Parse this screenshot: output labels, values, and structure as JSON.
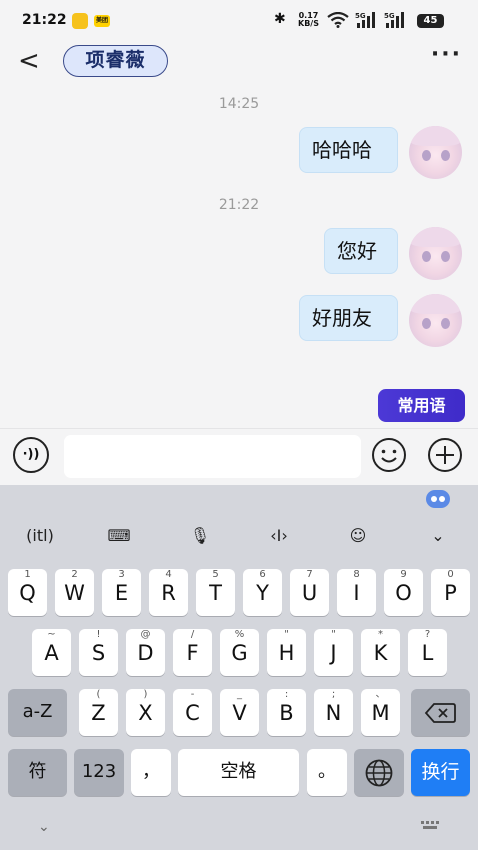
{
  "status": {
    "time": "21:22",
    "app_badge": "美团",
    "net_speed_value": "0.17",
    "net_speed_unit": "KB/S",
    "sig_label": "5G",
    "battery": "45"
  },
  "header": {
    "back_glyph": "<",
    "contact_name": "项睿薇",
    "more_glyph": "···"
  },
  "chat": {
    "timestamps": [
      "14:25",
      "21:22"
    ],
    "messages": [
      {
        "text": "哈哈哈",
        "from": "me"
      },
      {
        "text": "您好",
        "from": "me"
      },
      {
        "text": "好朋友",
        "from": "me"
      }
    ],
    "common_phrases_label": "常用语"
  },
  "input": {
    "value": "",
    "voice_glyph": "·))"
  },
  "keyboard": {
    "toolbar": [
      "(itl)",
      "⌨",
      "🎙",
      "‹I›",
      "☺",
      "⌄"
    ],
    "row1": [
      {
        "k": "Q",
        "s": "1"
      },
      {
        "k": "W",
        "s": "2"
      },
      {
        "k": "E",
        "s": "3"
      },
      {
        "k": "R",
        "s": "4"
      },
      {
        "k": "T",
        "s": "5"
      },
      {
        "k": "Y",
        "s": "6"
      },
      {
        "k": "U",
        "s": "7"
      },
      {
        "k": "I",
        "s": "8"
      },
      {
        "k": "O",
        "s": "9"
      },
      {
        "k": "P",
        "s": "0"
      }
    ],
    "row2": [
      {
        "k": "A",
        "s": "~"
      },
      {
        "k": "S",
        "s": "!"
      },
      {
        "k": "D",
        "s": "@"
      },
      {
        "k": "F",
        "s": "/"
      },
      {
        "k": "G",
        "s": "%"
      },
      {
        "k": "H",
        "s": "\""
      },
      {
        "k": "J",
        "s": "\""
      },
      {
        "k": "K",
        "s": "*"
      },
      {
        "k": "L",
        "s": "?"
      }
    ],
    "row3": [
      {
        "k": "Z",
        "s": "("
      },
      {
        "k": "X",
        "s": ")"
      },
      {
        "k": "C",
        "s": "-"
      },
      {
        "k": "V",
        "s": "_"
      },
      {
        "k": "B",
        "s": ":"
      },
      {
        "k": "N",
        "s": ";"
      },
      {
        "k": "M",
        "s": "、"
      }
    ],
    "case_key": "a-Z",
    "symbol_key": "符",
    "number_key": "123",
    "comma_key": "，",
    "space_key": "空格",
    "period_key": "。",
    "enter_key": "换行"
  }
}
